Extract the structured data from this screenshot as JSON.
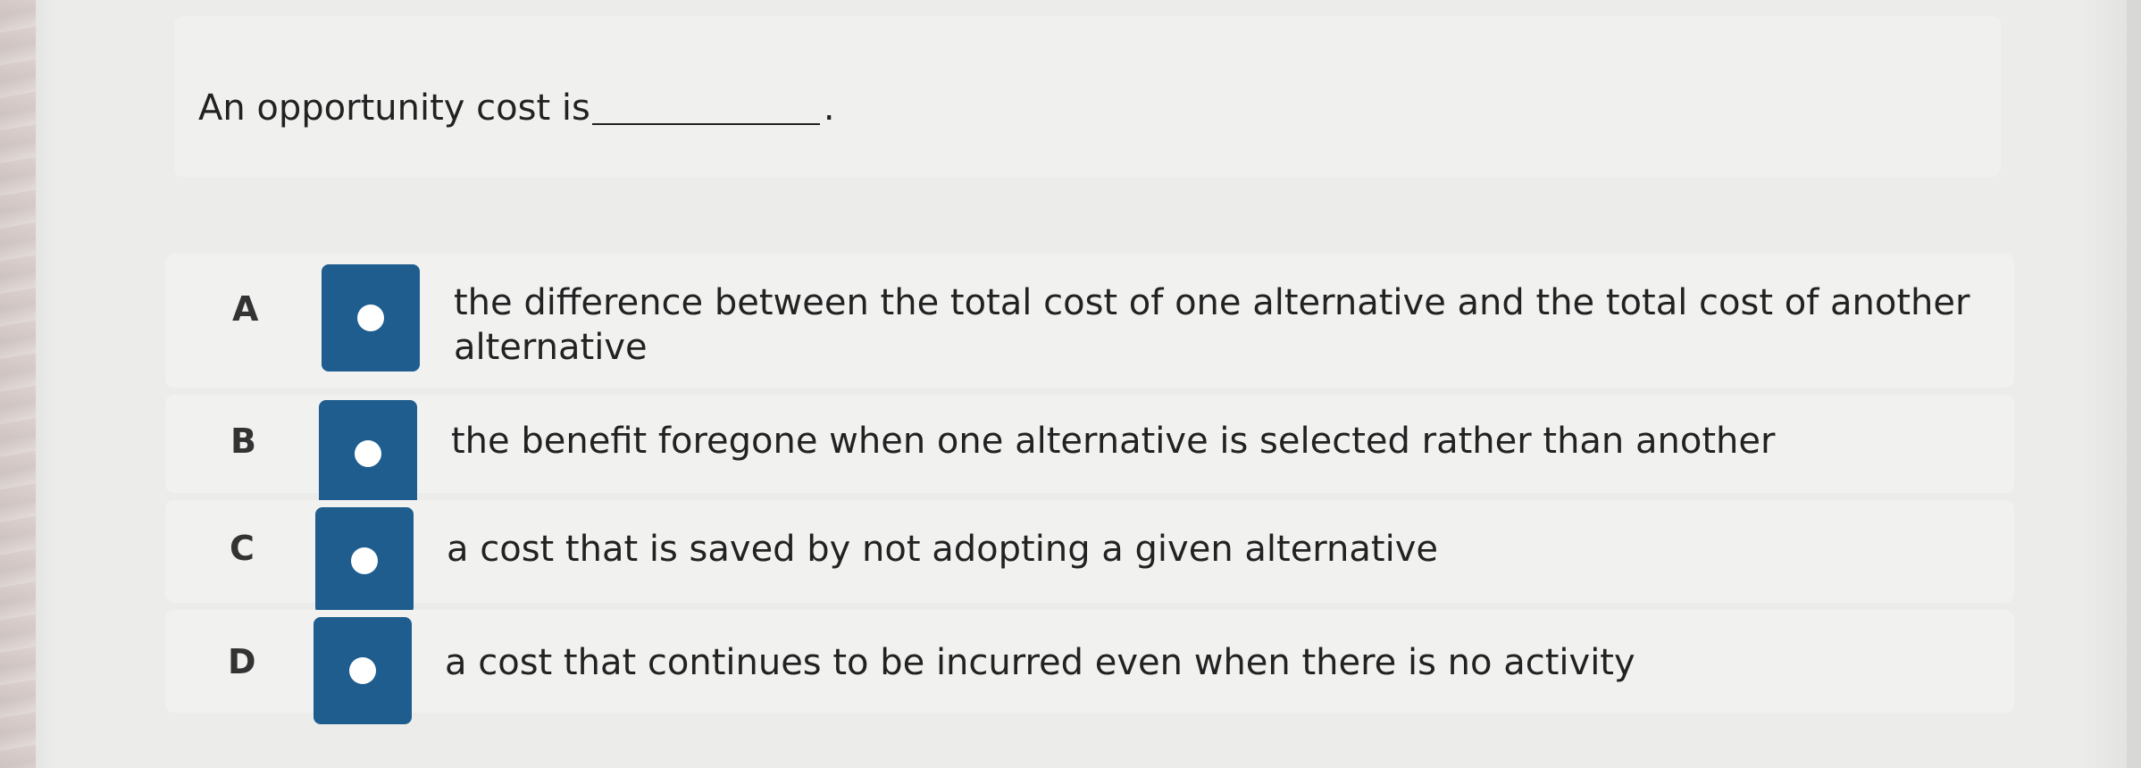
{
  "question": {
    "prefix": "An opportunity cost is",
    "suffix": "."
  },
  "options": [
    {
      "letter": "A",
      "text": "the difference between the total cost of one alternative and the total cost of another alternative"
    },
    {
      "letter": "B",
      "text": "the benefit foregone when one alternative is selected rather than another"
    },
    {
      "letter": "C",
      "text": "a cost that is saved by not adopting a given alternative"
    },
    {
      "letter": "D",
      "text": "a cost that continues to be incurred even when there is no activity"
    }
  ],
  "colors": {
    "radio_button": "#1f5d8f",
    "panel": "#f0f0ef",
    "background": "#ececea"
  },
  "icons": {
    "radio": "radio-dot-icon"
  }
}
